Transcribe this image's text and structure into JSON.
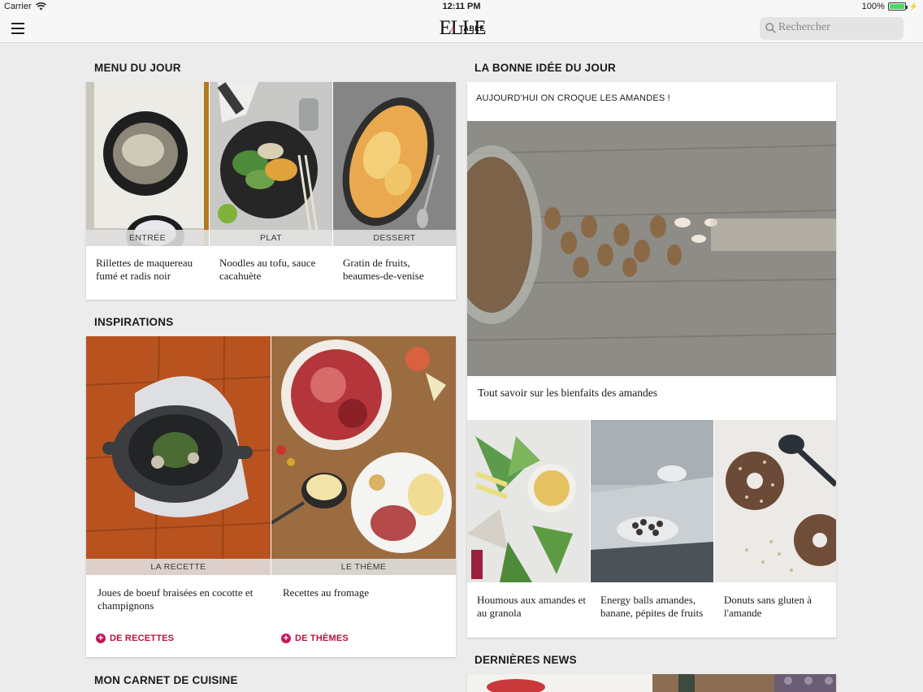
{
  "status": {
    "carrier": "Carrier",
    "time": "12:11 PM",
    "battery": "100%",
    "battery_level": 1.0
  },
  "nav": {
    "logo": "ELLE",
    "logo_sub": "à",
    "logo_sub2": "TABLE",
    "search_placeholder": "Rechercher"
  },
  "menu_du_jour": {
    "title": "MENU DU JOUR",
    "items": [
      {
        "badge": "ENTRÉE",
        "caption": "Rillettes de maquereau fumé et radis noir"
      },
      {
        "badge": "PLAT",
        "caption": "Noodles au tofu, sauce cacahuète"
      },
      {
        "badge": "DESSERT",
        "caption": "Gratin de fruits, beaumes-de-venise"
      }
    ]
  },
  "inspirations": {
    "title": "INSPIRATIONS",
    "items": [
      {
        "badge": "LA RECETTE",
        "caption": "Joues de boeuf braisées en cocotte et champignons",
        "more": "DE RECETTES"
      },
      {
        "badge": "LE THÈME",
        "caption": "Recettes au fromage",
        "more": "DE THÈMES"
      }
    ]
  },
  "carnet": {
    "title": "MON CARNET DE CUISINE"
  },
  "bonne_idee": {
    "title": "LA BONNE IDÉE DU JOUR",
    "subtitle": "AUJOURD'HUI ON CROQUE LES AMANDES !",
    "headline": "Tout savoir sur les bienfaits des amandes",
    "items": [
      {
        "caption": "Houmous aux amandes et au granola"
      },
      {
        "caption": "Energy balls amandes, banane, pépites de fruits"
      },
      {
        "caption": "Donuts sans gluten à l'amande"
      }
    ]
  },
  "news": {
    "title": "DERNIÈRES NEWS"
  }
}
